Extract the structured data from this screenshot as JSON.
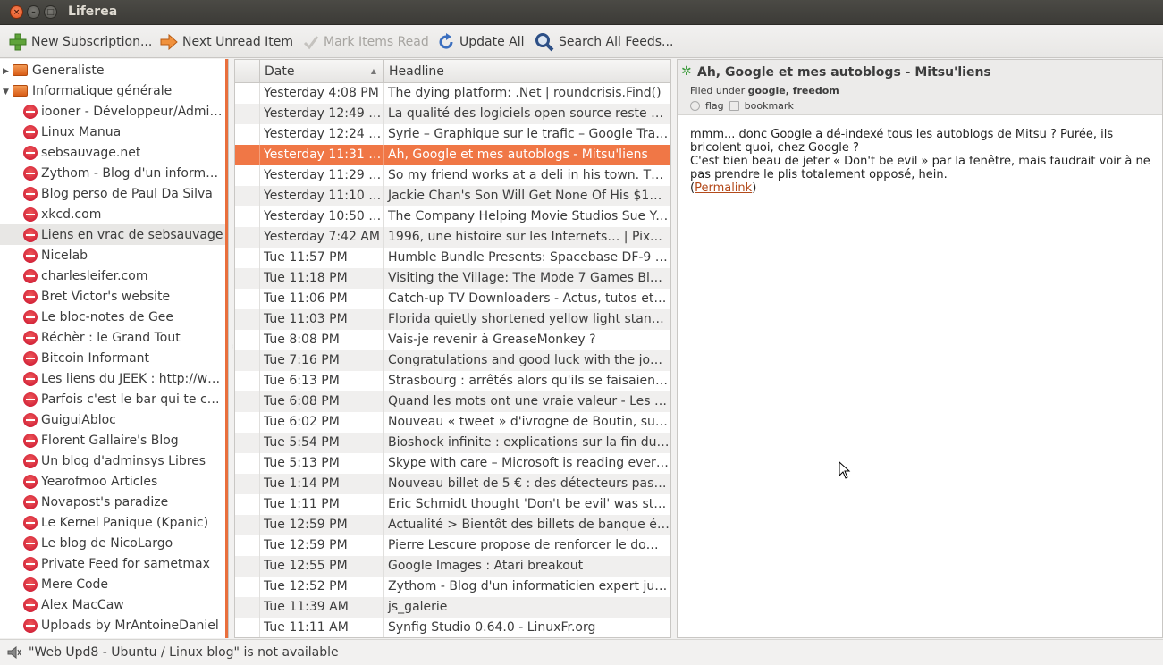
{
  "window": {
    "title": "Liferea"
  },
  "toolbar": {
    "new_subscription": "New Subscription...",
    "next_unread": "Next Unread Item",
    "mark_read": "Mark Items Read",
    "update_all": "Update All",
    "search_all": "Search All Feeds..."
  },
  "sidebar": {
    "folders": [
      "Generaliste",
      "Informatique générale"
    ],
    "feeds": [
      "iooner - Développeur/Admin...",
      "Linux Manua",
      "sebsauvage.net",
      "Zythom - Blog d'un informati...",
      "Blog perso de Paul Da Silva",
      "xkcd.com",
      "Liens en vrac de sebsauvage",
      "Nicelab",
      "charlesleifer.com",
      "Bret Victor's website",
      "Le bloc-notes de Gee",
      "Réchèr : le Grand Tout",
      "Bitcoin Informant",
      "Les liens du JEEK : http://ww...",
      "Parfois c'est le bar qui te co...",
      "GuiguiAbloc",
      "Florent Gallaire's Blog",
      "Un blog d'adminsys Libres",
      "Yearofmoo Articles",
      "Novapost's paradize",
      "Le Kernel Panique (Kpanic)",
      "Le blog de NicoLargo",
      "Private Feed for sametmax",
      "Mere Code",
      "Alex MacCaw",
      "Uploads by MrAntoineDaniel"
    ],
    "selected_feed_index": 6
  },
  "itemlist": {
    "headers": {
      "date": "Date",
      "headline": "Headline"
    },
    "selected_index": 3,
    "rows": [
      {
        "date": "Yesterday 4:08 PM",
        "headline": "The dying platform: .Net | roundcrisis.Find()"
      },
      {
        "date": "Yesterday 12:49 PM",
        "headline": "La qualité des logiciels open source reste éle..."
      },
      {
        "date": "Yesterday 12:24 PM",
        "headline": "Syrie – Graphique sur le trafic – Google Trans..."
      },
      {
        "date": "Yesterday 11:31 AM",
        "headline": "Ah, Google et mes autoblogs - Mitsu'liens"
      },
      {
        "date": "Yesterday 11:29 AM",
        "headline": "So my friend works at a deli in his town. This ..."
      },
      {
        "date": "Yesterday 11:10 AM",
        "headline": "Jackie Chan's Son Will Get None Of His $130 ..."
      },
      {
        "date": "Yesterday 10:50 AM",
        "headline": "The Company Helping Movie Studios Sue You..."
      },
      {
        "date": "Yesterday 7:42 AM",
        "headline": "1996, une histoire sur les Internets… | Pixelli..."
      },
      {
        "date": "Tue 11:57 PM",
        "headline": "Humble Bundle Presents: Spacebase DF-9 - Y..."
      },
      {
        "date": "Tue 11:18 PM",
        "headline": "Visiting the Village: The Mode 7 Games Blog ..."
      },
      {
        "date": "Tue 11:06 PM",
        "headline": "Catch-up TV Downloaders - Actus, tutos et a..."
      },
      {
        "date": "Tue 11:03 PM",
        "headline": "Florida quietly shortened yellow light standa..."
      },
      {
        "date": "Tue 8:08 PM",
        "headline": "Vais-je revenir à GreaseMonkey ?"
      },
      {
        "date": "Tue 7:16 PM",
        "headline": "Congratulations and good luck with the job s..."
      },
      {
        "date": "Tue 6:13 PM",
        "headline": "Strasbourg : arrêtés alors qu'ils se faisaient ..."
      },
      {
        "date": "Tue 6:08 PM",
        "headline": "Quand les mots ont une vraie valeur - Les par..."
      },
      {
        "date": "Tue 6:02 PM",
        "headline": "Nouveau « tweet » d'ivrogne de Boutin, sur la..."
      },
      {
        "date": "Tue 5:54 PM",
        "headline": "Bioshock infinite : explications sur la fin du je..."
      },
      {
        "date": "Tue 5:13 PM",
        "headline": "Skype with care – Microsoft is reading everyt..."
      },
      {
        "date": "Tue 1:14 PM",
        "headline": "Nouveau billet de 5 € : des détecteurs pas à j..."
      },
      {
        "date": "Tue 1:11 PM",
        "headline": "Eric Schmidt thought 'Don't be evil' was stup..."
      },
      {
        "date": "Tue 12:59 PM",
        "headline": "Actualité > Bientôt des billets de banque éq..."
      },
      {
        "date": "Tue 12:59 PM",
        "headline": "Pierre Lescure propose de renforcer le dom..."
      },
      {
        "date": "Tue 12:55 PM",
        "headline": "Google Images : Atari breakout"
      },
      {
        "date": "Tue 12:52 PM",
        "headline": "Zythom - Blog d'un informaticien expert judi..."
      },
      {
        "date": "Tue 11:39 AM",
        "headline": "js_galerie"
      },
      {
        "date": "Tue 11:11 AM",
        "headline": "Synfig Studio 0.64.0 - LinuxFr.org"
      }
    ]
  },
  "viewer": {
    "title": "Ah, Google et mes autoblogs - Mitsu'liens",
    "filed_prefix": "Filed under",
    "filed_tags": "google, freedom",
    "flag_label": "flag",
    "bookmark_label": "bookmark",
    "body_line1": "mmm... donc Google a dé-indexé tous les autoblogs de Mitsu ?  Purée, ils bricolent quoi, chez Google ?",
    "body_line2": "C'est bien beau de jeter « Don't be evil » par la fenêtre, mais faudrait voir à ne pas prendre le plis totalement opposé, hein.",
    "permalink_open": "(",
    "permalink": "Permalink",
    "permalink_close": ")"
  },
  "statusbar": {
    "text": "\"Web Upd8 - Ubuntu / Linux blog\" is not available"
  },
  "colors": {
    "selection": "#f07746",
    "sidebar_accent": "#e96f3d",
    "titlebar": "#3c3b37"
  }
}
